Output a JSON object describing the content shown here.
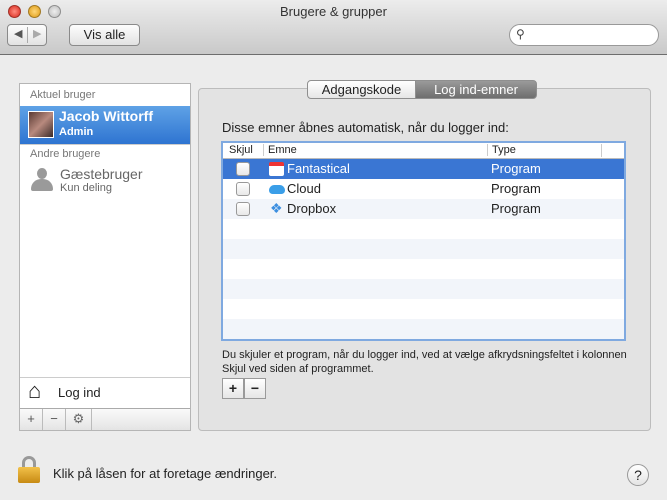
{
  "window": {
    "title": "Brugere & grupper",
    "show_all": "Vis alle",
    "search_placeholder": ""
  },
  "sidebar": {
    "current_section": "Aktuel bruger",
    "current_user": {
      "name": "Jacob Wittorff",
      "role": "Admin"
    },
    "other_section": "Andre brugere",
    "guest": {
      "name": "Gæstebruger",
      "role": "Kun deling"
    },
    "login_options": "Log ind",
    "add": "+",
    "remove": "−"
  },
  "tabs": [
    {
      "label": "Adgangskode",
      "active": false
    },
    {
      "label": "Log ind-emner",
      "active": true
    }
  ],
  "main": {
    "intro": "Disse emner åbnes automatisk, når du logger ind:",
    "columns": [
      "Skjul",
      "Emne",
      "Type"
    ],
    "rows": [
      {
        "name": "Fantastical",
        "type": "Program",
        "hidden": false,
        "selected": true
      },
      {
        "name": "Cloud",
        "type": "Program",
        "hidden": false,
        "selected": false
      },
      {
        "name": "Dropbox",
        "type": "Program",
        "hidden": false,
        "selected": false
      }
    ],
    "footnote": "Du skjuler et program, når du logger ind, ved at vælge afkrydsningsfeltet i kolonnen Skjul ved siden af programmet.",
    "add": "+",
    "remove": "−"
  },
  "footer": {
    "lock_text": "Klik på låsen for at foretage ændringer.",
    "help": "?"
  }
}
